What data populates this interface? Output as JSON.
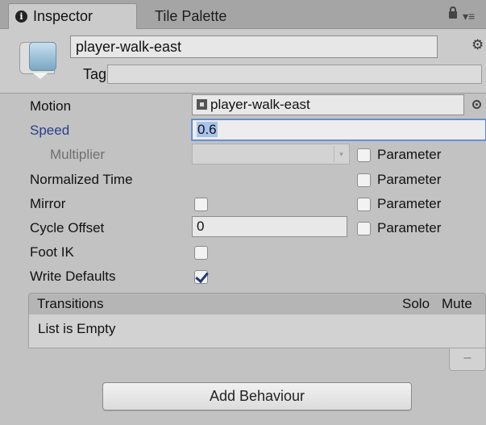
{
  "tabs": {
    "inspector_label": "Inspector",
    "tile_palette_label": "Tile Palette"
  },
  "header": {
    "state_name": "player-walk-east",
    "tag_label": "Tag",
    "tag_value": ""
  },
  "properties": {
    "motion_label": "Motion",
    "motion_value": "player-walk-east",
    "speed_label": "Speed",
    "speed_value": "0.6",
    "multiplier_label": "Multiplier",
    "multiplier_value": "",
    "normalized_time_label": "Normalized Time",
    "mirror_label": "Mirror",
    "mirror_checked": false,
    "cycle_offset_label": "Cycle Offset",
    "cycle_offset_value": "0",
    "foot_ik_label": "Foot IK",
    "foot_ik_checked": false,
    "write_defaults_label": "Write Defaults",
    "write_defaults_checked": true,
    "parameter_label": "Parameter"
  },
  "transitions": {
    "title": "Transitions",
    "solo_label": "Solo",
    "mute_label": "Mute",
    "empty_text": "List is Empty",
    "remove_label": "–"
  },
  "add_behaviour_label": "Add Behaviour",
  "icons": {
    "info": "info-icon",
    "lock": "lock-icon",
    "menu": "menu-icon",
    "gear": "gear-icon",
    "asset": "animation-clip-icon",
    "target": "object-picker-icon"
  },
  "colors": {
    "speed_label_color": "#27408b",
    "speed_focus_border": "#5b87cf",
    "speed_selection": "#a9c3ee",
    "checkmark": "#1e3a78"
  }
}
